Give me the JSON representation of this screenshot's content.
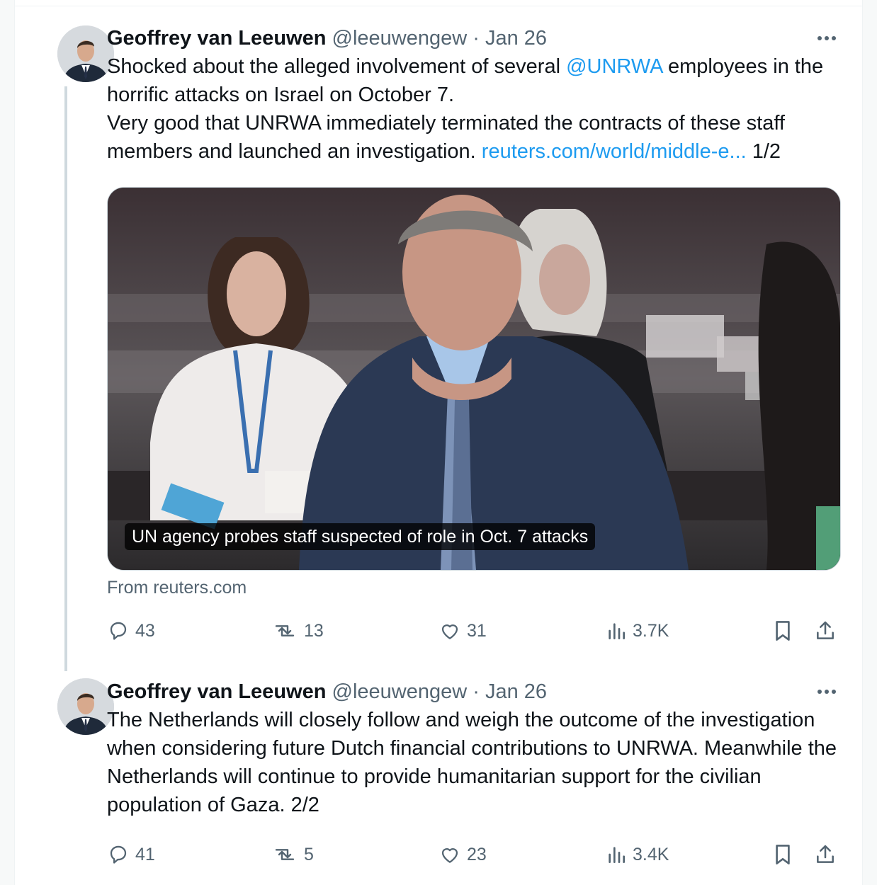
{
  "tweets": [
    {
      "author_name": "Geoffrey van Leeuwen",
      "handle": "@leeuwengew",
      "separator": "·",
      "date": "Jan 26",
      "text_before_mention": "Shocked about the alleged involvement of several ",
      "mention": "@UNRWA",
      "text_after_mention": " employees in the horrific attacks on Israel on October 7.",
      "text_line2_start": "Very good that UNRWA immediately terminated the contracts of these staff members and launched an investigation. ",
      "link": "reuters.com/world/middle-e...",
      "thread_index": " 1/2",
      "card": {
        "title": "UN agency probes staff suspected of role in Oct. 7 attacks",
        "source": "From reuters.com"
      },
      "stats": {
        "replies": "43",
        "reposts": "13",
        "likes": "31",
        "views": "3.7K"
      }
    },
    {
      "author_name": "Geoffrey van Leeuwen",
      "handle": "@leeuwengew",
      "separator": "·",
      "date": "Jan 26",
      "text": "The Netherlands will closely follow and weigh the outcome of the investigation when considering future Dutch financial contributions to UNRWA. Meanwhile the Netherlands will continue to provide humanitarian support for the civilian population of Gaza. 2/2",
      "stats": {
        "replies": "41",
        "reposts": "5",
        "likes": "23",
        "views": "3.4K"
      }
    }
  ],
  "colors": {
    "link": "#1d9bf0",
    "muted": "#536471",
    "text": "#0f1419",
    "thread_line": "#cfd9de"
  },
  "icons": [
    "more-icon",
    "reply-icon",
    "repost-icon",
    "like-icon",
    "views-icon",
    "bookmark-icon",
    "share-icon"
  ]
}
